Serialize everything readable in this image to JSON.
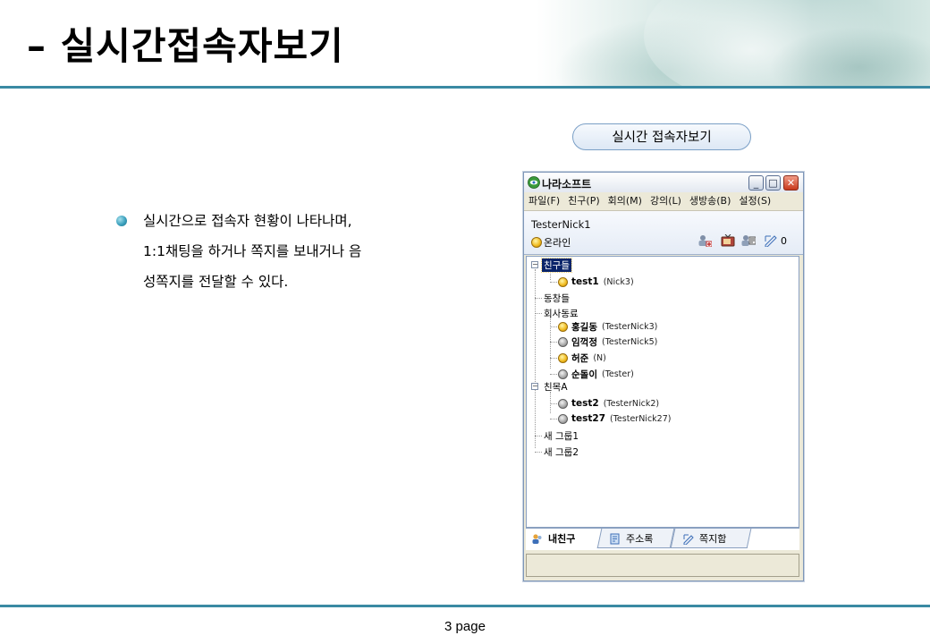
{
  "slide": {
    "title": "– 실시간접속자보기",
    "page": "3 page",
    "caption": "실시간 접속자보기",
    "description_lines": [
      "실시간으로 접속자 현황이 나타나며,",
      "1:1채팅을 하거나 쪽지를 보내거나 음",
      "성쪽지를 전달할 수 있다."
    ]
  },
  "window": {
    "title": "나라소프트",
    "menu": [
      "파일(F)",
      "친구(P)",
      "회의(M)",
      "강의(L)",
      "생방송(B)",
      "설정(S)"
    ],
    "user": {
      "name": "TesterNick1",
      "status": "온라인",
      "message_count": "0"
    },
    "toolbar_icons": [
      "add-friend-icon",
      "tv-icon",
      "video-chat-icon",
      "memo-icon"
    ],
    "tree": {
      "groups": [
        {
          "label": "친구들",
          "friends": [
            {
              "name": "test1",
              "nick": "(Nick3)",
              "online": true
            }
          ]
        },
        {
          "label": "동창들",
          "friends": []
        },
        {
          "label": "회사동료",
          "friends": [
            {
              "name": "홍길동",
              "nick": "(TesterNick3)",
              "online": true
            },
            {
              "name": "임꺽정",
              "nick": "(TesterNick5)",
              "online": false
            },
            {
              "name": "허준",
              "nick": "(N)",
              "online": true
            },
            {
              "name": "순돌이",
              "nick": "(Tester)",
              "online": false
            }
          ]
        },
        {
          "label": "친목A",
          "friends": [
            {
              "name": "test2",
              "nick": "(TesterNick2)",
              "online": false
            },
            {
              "name": "test27",
              "nick": "(TesterNick27)",
              "online": false
            }
          ]
        },
        {
          "label": "새 그룹1",
          "friends": []
        },
        {
          "label": "새 그룹2",
          "friends": []
        }
      ]
    },
    "tabs": [
      "내친구",
      "주소록",
      "쪽지함"
    ]
  },
  "colors": {
    "rule": "#3a8aa3",
    "selection": "#0a246a",
    "online": "#f0b91c",
    "offline": "#a8a8a8"
  }
}
